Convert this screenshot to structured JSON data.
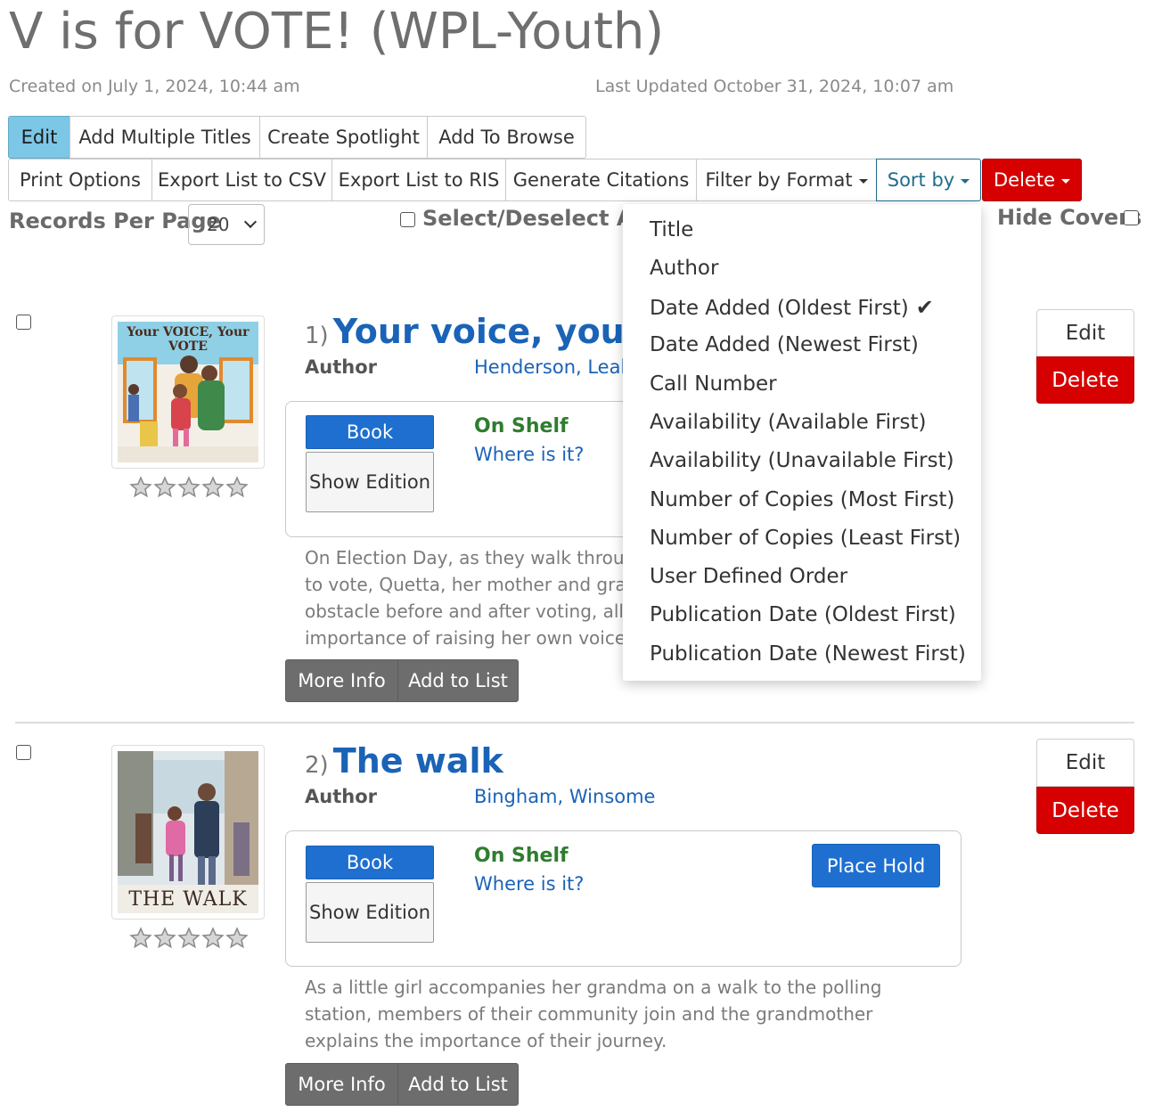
{
  "page": {
    "title": "V is for VOTE! (WPL-Youth)",
    "created": "Created on July 1, 2024, 10:44 am",
    "updated": "Last Updated October 31, 2024, 10:07 am"
  },
  "toolbar1": {
    "edit": "Edit",
    "add_multiple": "Add Multiple Titles",
    "create_spotlight": "Create Spotlight",
    "add_to_browse": "Add To Browse"
  },
  "toolbar2": {
    "print_options": "Print Options",
    "export_csv": "Export List to CSV",
    "export_ris": "Export List to RIS",
    "generate_citations": "Generate Citations",
    "filter_by_format": "Filter by Format",
    "sort_by": "Sort by",
    "delete": "Delete"
  },
  "controls": {
    "records_per_page_label": "Records Per Page",
    "records_per_page_value": "20",
    "select_all_label": "Select/Deselect All",
    "hide_covers_label": "Hide Covers"
  },
  "sort_menu": {
    "items": [
      "Title",
      "Author",
      "Date Added (Oldest First)",
      "Date Added (Newest First)",
      "Call Number",
      "Availability (Available First)",
      "Availability (Unavailable First)",
      "Number of Copies (Most First)",
      "Number of Copies (Least First)",
      "User Defined Order",
      "Publication Date (Oldest First)",
      "Publication Date (Newest First)"
    ],
    "selected_index": 2
  },
  "records": [
    {
      "num": "1)",
      "title": "Your voice, your vote",
      "author_label": "Author",
      "author": "Henderson, Leah",
      "format": "Book",
      "show_edition": "Show Edition",
      "status": "On Shelf",
      "where": "Where is it?",
      "description": "On Election Day, as they walk through their neighborhood on their way to vote, Quetta, her mother and grandmother encounter obstacle after obstacle before and after voting, all while showing Quetta the importance of raising her own voice.",
      "more_info": "More Info",
      "add_to_list": "Add to List",
      "edit": "Edit",
      "delete": "Delete",
      "rating": 0,
      "cover": {
        "title_text": "Your VOICE, Your VOTE",
        "colors": [
          "#7fc9e0",
          "#e8a23a",
          "#c33b3b"
        ]
      }
    },
    {
      "num": "2)",
      "title": "The walk",
      "author_label": "Author",
      "author": "Bingham, Winsome",
      "format": "Book",
      "show_edition": "Show Edition",
      "status": "On Shelf",
      "where": "Where is it?",
      "place_hold": "Place Hold",
      "description": "As a little girl accompanies her grandma on a walk to the polling station, members of their community join and the grandmother explains the importance of their journey.",
      "more_info": "More Info",
      "add_to_list": "Add to List",
      "edit": "Edit",
      "delete": "Delete",
      "rating": 0,
      "cover": {
        "title_text": "THE WALK",
        "colors": [
          "#a9c6d8",
          "#5a6f7a",
          "#d96aa0"
        ]
      }
    }
  ],
  "colors": {
    "link": "#1a63b7",
    "primary_button": "#1e6fd0",
    "danger": "#d60000",
    "status_green": "#2f7d2f",
    "edit_active": "#7cc6e6"
  }
}
